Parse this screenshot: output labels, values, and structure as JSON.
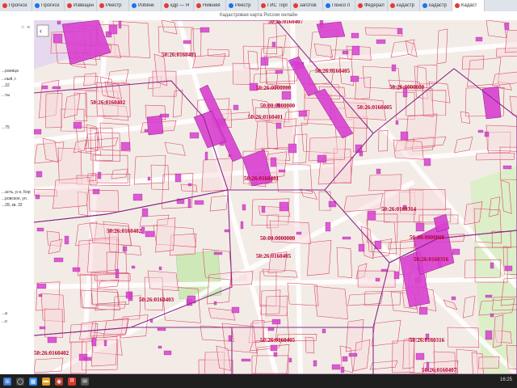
{
  "browser": {
    "tabs": [
      {
        "label": "Прогноз",
        "active": false
      },
      {
        "label": "Прогноз",
        "active": false
      },
      {
        "label": "Извещени",
        "active": false
      },
      {
        "label": "Реестр",
        "active": false
      },
      {
        "label": "Избёнк",
        "active": false
      },
      {
        "label": "кдр — Я",
        "active": false
      },
      {
        "label": "Нижняя",
        "active": false
      },
      {
        "label": "Реестр",
        "active": false
      },
      {
        "label": "ГИС Торг",
        "active": false
      },
      {
        "label": "заготов",
        "active": false
      },
      {
        "label": "Пенсо п",
        "active": false
      },
      {
        "label": "Федерал",
        "active": false
      },
      {
        "label": "кадастр",
        "active": false
      },
      {
        "label": "кадастр",
        "active": false
      },
      {
        "label": "Кадаст",
        "active": true
      }
    ],
    "page_title": "Кадастровая карта России онлайн"
  },
  "sidepanel": {
    "lines": [
      {
        "text": "...раница"
      },
      {
        "text": "...ный, г."
      },
      {
        "text": "...32"
      },
      {
        "text": "...ты"
      },
      {
        "text": "...75"
      },
      {
        "text": "...асть, р-н, Кор"
      },
      {
        "text": "...ровское, ул."
      },
      {
        "text": "...28, кв. 32"
      },
      {
        "text": "...а"
      },
      {
        "text": "...о"
      }
    ]
  },
  "map": {
    "cadastral_labels": [
      {
        "text": "50:26:0160407"
      },
      {
        "text": "50:26:0160401"
      },
      {
        "text": "50:26:0160405"
      },
      {
        "text": "50:26:0000000"
      },
      {
        "text": "50:00:0000000"
      },
      {
        "text": "50:26:0160401"
      },
      {
        "text": "50:26:0160402"
      },
      {
        "text": "50:26:0160405"
      },
      {
        "text": "50:26:0000000"
      },
      {
        "text": "50:26:0160401"
      },
      {
        "text": "50:26:0160314"
      },
      {
        "text": "50:26:0160402"
      },
      {
        "text": "50:00:0000000"
      },
      {
        "text": "50:00:0000000"
      },
      {
        "text": "50:26:0160316"
      },
      {
        "text": "50:26:0160405"
      },
      {
        "text": "50:26:0160403"
      },
      {
        "text": "50:26:0160316"
      },
      {
        "text": "50:26:0160405"
      },
      {
        "text": "50:26:0160407"
      },
      {
        "text": "50:26:0160402"
      }
    ],
    "colors": {
      "background": "#f3ece6",
      "parcel_border": "#d94a6a",
      "parcel_fill": "#f7d9dc",
      "building_fill": "#d83fd0",
      "quarter_border": "#8a2a8a",
      "road": "#ffffff",
      "green": "#cfe8b8"
    }
  },
  "taskbar": {
    "time": "16:25"
  }
}
